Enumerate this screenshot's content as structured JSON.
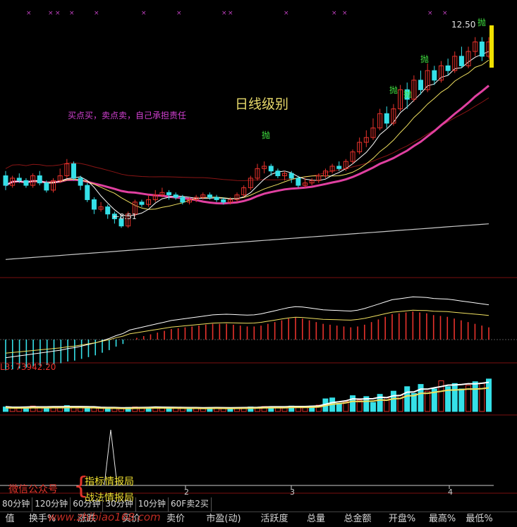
{
  "chart_data": [
    {
      "type": "candlestick",
      "title": "日线级别",
      "annotation": "买点买，卖点卖，自己承担责任",
      "high_label": "12.50",
      "low_label": "8.51",
      "signal_label": "抛",
      "ylim": [
        7.5,
        13.1
      ],
      "candles": [
        [
          9.6,
          9.4,
          9.7,
          9.3
        ],
        [
          9.4,
          9.55,
          9.6,
          9.35
        ],
        [
          9.55,
          9.5,
          9.65,
          9.45
        ],
        [
          9.5,
          9.4,
          9.55,
          9.35
        ],
        [
          9.4,
          9.6,
          9.65,
          9.35
        ],
        [
          9.6,
          9.45,
          9.7,
          9.4
        ],
        [
          9.45,
          9.3,
          9.5,
          9.25
        ],
        [
          9.3,
          9.5,
          9.55,
          9.25
        ],
        [
          9.5,
          9.6,
          9.75,
          9.45
        ],
        [
          9.6,
          9.85,
          9.95,
          9.55
        ],
        [
          9.85,
          9.55,
          9.9,
          9.5
        ],
        [
          9.55,
          9.4,
          9.6,
          9.3
        ],
        [
          9.4,
          9.1,
          9.45,
          9.05
        ],
        [
          9.1,
          8.9,
          9.15,
          8.8
        ],
        [
          8.9,
          8.95,
          9.05,
          8.85
        ],
        [
          8.95,
          8.8,
          9.0,
          8.7
        ],
        [
          8.8,
          8.7,
          8.85,
          8.6
        ],
        [
          8.7,
          8.55,
          8.75,
          8.51
        ],
        [
          8.55,
          8.8,
          8.85,
          8.51
        ],
        [
          8.8,
          9.05,
          9.1,
          8.75
        ],
        [
          9.05,
          9.0,
          9.1,
          8.95
        ],
        [
          9.0,
          9.1,
          9.2,
          8.95
        ],
        [
          9.1,
          9.2,
          9.3,
          9.05
        ],
        [
          9.2,
          9.25,
          9.35,
          9.15
        ],
        [
          9.25,
          9.2,
          9.3,
          9.1
        ],
        [
          9.2,
          9.15,
          9.25,
          9.1
        ],
        [
          9.15,
          9.05,
          9.2,
          9.0
        ],
        [
          9.05,
          9.1,
          9.15,
          9.0
        ],
        [
          9.1,
          9.15,
          9.2,
          9.05
        ],
        [
          9.15,
          9.2,
          9.25,
          9.1
        ],
        [
          9.2,
          9.15,
          9.25,
          9.1
        ],
        [
          9.15,
          9.1,
          9.2,
          9.05
        ],
        [
          9.1,
          9.05,
          9.15,
          9.0
        ],
        [
          9.05,
          9.1,
          9.15,
          9.0
        ],
        [
          9.1,
          9.2,
          9.25,
          9.05
        ],
        [
          9.2,
          9.35,
          9.4,
          9.15
        ],
        [
          9.35,
          9.55,
          9.6,
          9.3
        ],
        [
          9.55,
          9.75,
          9.85,
          9.5
        ],
        [
          9.75,
          9.8,
          9.9,
          9.65
        ],
        [
          9.8,
          9.7,
          9.85,
          9.6
        ],
        [
          9.7,
          9.6,
          9.75,
          9.55
        ],
        [
          9.6,
          9.65,
          9.7,
          9.5
        ],
        [
          9.65,
          9.55,
          9.7,
          9.45
        ],
        [
          9.55,
          9.4,
          9.6,
          9.35
        ],
        [
          9.4,
          9.45,
          9.55,
          9.35
        ],
        [
          9.45,
          9.5,
          9.55,
          9.4
        ],
        [
          9.5,
          9.6,
          9.65,
          9.45
        ],
        [
          9.6,
          9.7,
          9.75,
          9.55
        ],
        [
          9.7,
          9.8,
          9.85,
          9.65
        ],
        [
          9.8,
          9.75,
          9.9,
          9.7
        ],
        [
          9.75,
          9.9,
          9.95,
          9.7
        ],
        [
          9.9,
          10.1,
          10.15,
          9.85
        ],
        [
          10.1,
          10.3,
          10.4,
          10.05
        ],
        [
          10.3,
          10.4,
          10.55,
          10.2
        ],
        [
          10.4,
          10.6,
          10.8,
          10.35
        ],
        [
          10.6,
          10.9,
          11.0,
          10.55
        ],
        [
          10.9,
          10.7,
          11.05,
          10.6
        ],
        [
          10.7,
          11.0,
          11.1,
          10.65
        ],
        [
          11.0,
          11.4,
          11.5,
          10.95
        ],
        [
          11.4,
          11.2,
          11.55,
          11.0
        ],
        [
          11.2,
          11.6,
          11.7,
          11.15
        ],
        [
          11.6,
          11.4,
          11.8,
          11.3
        ],
        [
          11.4,
          11.8,
          11.95,
          11.35
        ],
        [
          11.8,
          11.6,
          11.9,
          11.5
        ],
        [
          11.6,
          11.9,
          12.0,
          11.55
        ],
        [
          11.9,
          11.8,
          12.05,
          11.7
        ],
        [
          11.8,
          12.1,
          12.2,
          11.75
        ],
        [
          12.1,
          11.9,
          12.3,
          11.85
        ],
        [
          11.9,
          12.2,
          12.3,
          11.85
        ],
        [
          12.2,
          12.4,
          12.5,
          12.1
        ],
        [
          12.4,
          12.1,
          12.5,
          12.0
        ],
        [
          12.1,
          12.4,
          12.5,
          12.05
        ]
      ]
    },
    {
      "type": "macd",
      "ylim": [
        -1,
        1
      ],
      "histogram": [
        -0.35,
        -0.34,
        -0.33,
        -0.32,
        -0.31,
        -0.3,
        -0.29,
        -0.28,
        -0.27,
        -0.25,
        -0.24,
        -0.22,
        -0.2,
        -0.18,
        -0.15,
        -0.12,
        -0.08,
        -0.05,
        0.0,
        0.02,
        0.04,
        0.06,
        0.08,
        0.1,
        0.12,
        0.13,
        0.14,
        0.15,
        0.16,
        0.17,
        0.18,
        0.18,
        0.18,
        0.17,
        0.16,
        0.15,
        0.15,
        0.16,
        0.18,
        0.2,
        0.22,
        0.24,
        0.25,
        0.24,
        0.22,
        0.2,
        0.18,
        0.17,
        0.16,
        0.15,
        0.14,
        0.15,
        0.17,
        0.2,
        0.23,
        0.26,
        0.29,
        0.3,
        0.31,
        0.32,
        0.31,
        0.3,
        0.28,
        0.27,
        0.26,
        0.24,
        0.22,
        0.2,
        0.18,
        0.16,
        0.14
      ]
    },
    {
      "type": "bar",
      "label": "L3: 73942.20",
      "values": [
        0.1,
        0.08,
        0.09,
        0.1,
        0.12,
        0.09,
        0.08,
        0.11,
        0.1,
        0.13,
        0.09,
        0.08,
        0.1,
        0.09,
        0.08,
        0.07,
        0.08,
        0.07,
        0.09,
        0.1,
        0.08,
        0.09,
        0.1,
        0.08,
        0.09,
        0.07,
        0.08,
        0.09,
        0.08,
        0.07,
        0.08,
        0.09,
        0.08,
        0.07,
        0.08,
        0.09,
        0.1,
        0.09,
        0.11,
        0.1,
        0.09,
        0.1,
        0.12,
        0.11,
        0.1,
        0.12,
        0.14,
        0.28,
        0.3,
        0.18,
        0.22,
        0.35,
        0.25,
        0.33,
        0.2,
        0.38,
        0.3,
        0.45,
        0.36,
        0.55,
        0.4,
        0.6,
        0.45,
        0.5,
        0.68,
        0.55,
        0.62,
        0.5,
        0.58,
        0.66,
        0.62,
        0.72
      ]
    }
  ],
  "watermark": {
    "wechat": "微信公众号",
    "brace": "{",
    "line1": "指标情报局",
    "line2": "战法情报局",
    "site": "www.zhibiao168.com"
  },
  "timeaxis": [
    "2",
    "3",
    "4"
  ],
  "periods": [
    "80分钟",
    "120分钟",
    "60分钟",
    "30分钟",
    "10分钟",
    "60F卖2买"
  ],
  "columns": [
    "值",
    "换手%",
    "涨跌",
    "买价",
    "卖价",
    "市盈(动)",
    "活跃度",
    "总量",
    "总金额",
    "开盘%",
    "最高%",
    "最低%"
  ],
  "colors": {
    "up": "#e8322c",
    "down": "#35e0e8",
    "ma5": "#ffffff",
    "ma10": "#f0e060",
    "ma20": "#e040a0",
    "ma60": "#c8c8c8"
  }
}
